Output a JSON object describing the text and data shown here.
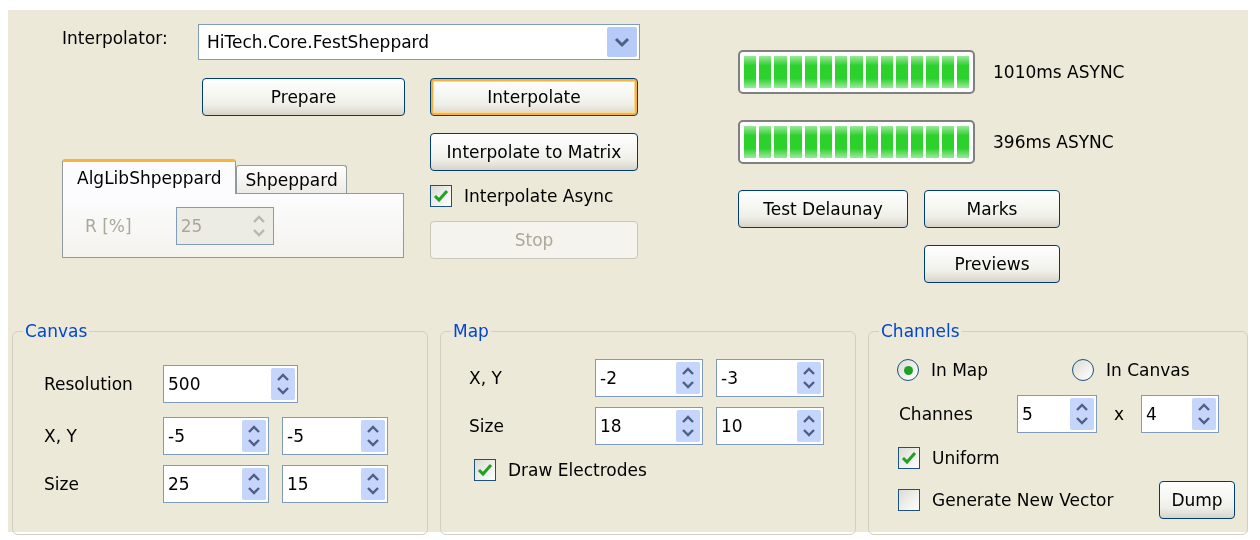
{
  "interpolator": {
    "label": "Interpolator:",
    "value": "HiTech.Core.FestSheppard"
  },
  "main_buttons": [
    {
      "label": "Prepare",
      "focused": false
    },
    {
      "label": "Interpolate",
      "focused": true
    }
  ],
  "tabs": [
    {
      "label": "AlgLibShpeppard",
      "selected": true
    },
    {
      "label": "Shpeppard",
      "selected": false
    }
  ],
  "tab_panel": {
    "label": "R [%]",
    "value": "25",
    "disabled": true
  },
  "matrix_button": "Interpolate to Matrix",
  "async_checkbox": {
    "label": "Interpolate Async",
    "checked": true
  },
  "stop_button": {
    "label": "Stop",
    "disabled": true
  },
  "progress": [
    {
      "level": 1,
      "reading": "1010ms ASYNC"
    },
    {
      "level": 1,
      "reading": "396ms ASYNC"
    }
  ],
  "tool_buttons": [
    "Test Delaunay",
    "Marks",
    "Previews"
  ],
  "canvas": {
    "title": "Canvas",
    "rows": [
      {
        "label": "Resolution",
        "fields": [
          "500"
        ]
      },
      {
        "label": "X, Y",
        "fields": [
          "-5",
          "-5"
        ]
      },
      {
        "label": "Size",
        "fields": [
          "25",
          "15"
        ]
      }
    ]
  },
  "map": {
    "title": "Map",
    "rows": [
      {
        "label": "X, Y",
        "fields": [
          "-2",
          "-3"
        ]
      },
      {
        "label": "Size",
        "fields": [
          "18",
          "10"
        ]
      }
    ],
    "checkbox": {
      "label": "Draw Electrodes",
      "checked": true
    }
  },
  "channels": {
    "title": "Channels",
    "radios": [
      {
        "label": "In Map",
        "selected": true
      },
      {
        "label": "In Canvas",
        "selected": false
      }
    ],
    "count": {
      "label": "Channes",
      "first": "5",
      "separator": "x",
      "second": "4"
    },
    "checkboxes": [
      {
        "label": "Uniform",
        "checked": true
      },
      {
        "label": "Generate New Vector",
        "checked": false
      }
    ],
    "dump_button": "Dump"
  }
}
